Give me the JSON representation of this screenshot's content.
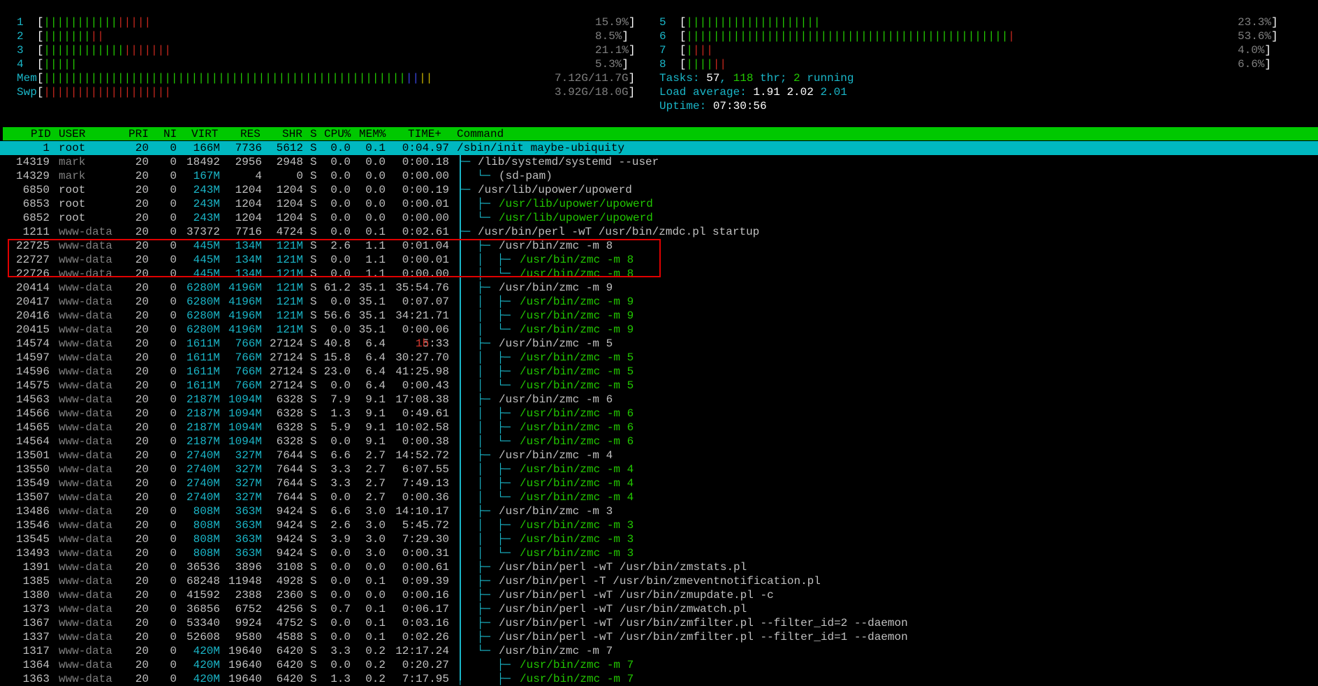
{
  "cpus": [
    {
      "label": "1",
      "green": "|||||||||||",
      "red": "|||||",
      "value": "15.9%"
    },
    {
      "label": "2",
      "green": "|||||||",
      "red": "||",
      "value": "8.5%"
    },
    {
      "label": "3",
      "green": "||||||||||||",
      "red": "|||||||",
      "value": "21.1%"
    },
    {
      "label": "4",
      "green": "|||||",
      "red": "",
      "value": "5.3%"
    },
    {
      "label": "5",
      "green": "||||||||||||||||||||",
      "red": "",
      "value": "23.3%"
    },
    {
      "label": "6",
      "green": "||||||||||||||||||||||||||||||||||||||||||||||||",
      "red": "|",
      "value": "53.6%"
    },
    {
      "label": "7",
      "green": "|",
      "red": "|||",
      "value": "4.0%"
    },
    {
      "label": "8",
      "green": "||||",
      "red": "||",
      "value": "6.6%"
    }
  ],
  "mem": {
    "label": "Mem",
    "green": "||||||||||||||||||||||||||||||||||||||||||||||||||||||",
    "blue": "||",
    "yellow": "||",
    "value": "7.12G/11.7G"
  },
  "swp": {
    "label": "Swp",
    "red": "|||||||||||||||||||",
    "value": "3.92G/18.0G"
  },
  "tasks": {
    "label": "Tasks: ",
    "count": "57",
    "sep1": ", ",
    "thr": "118",
    "thr_label": " thr; ",
    "running": "2",
    "running_label": " running"
  },
  "load": {
    "label": "Load average: ",
    "one": "1.91",
    "five": "2.02",
    "fifteen": "2.01"
  },
  "uptime": {
    "label": "Uptime: ",
    "value": "07:30:56"
  },
  "header": {
    "pid": "PID",
    "user": "USER",
    "pri": "PRI",
    "ni": "NI",
    "virt": "VIRT",
    "res": "RES",
    "shr": "SHR",
    "s": "S",
    "cpu": "CPU%",
    "mem": "MEM%",
    "time": "TIME+",
    "cmd": "Command"
  },
  "processes": [
    {
      "pid": "1",
      "user": "root",
      "pri": "20",
      "ni": "0",
      "virt": "166M",
      "res": "7736",
      "shr": "5612",
      "s": "S",
      "cpu": "0.0",
      "mem": "0.1",
      "time": "0:04.97",
      "tree": "",
      "cmd": "/sbin/init maybe-ubiquity",
      "thread": false,
      "selected": true
    },
    {
      "pid": "14319",
      "user": "mark",
      "pri": "20",
      "ni": "0",
      "virt": "18492",
      "res": "2956",
      "shr": "2948",
      "s": "S",
      "cpu": "0.0",
      "mem": "0.0",
      "time": "0:00.18",
      "tree": "├─ ",
      "cmd": "/lib/systemd/systemd --user",
      "thread": false
    },
    {
      "pid": "14329",
      "user": "mark",
      "pri": "20",
      "ni": "0",
      "virt": "167M",
      "res": "4",
      "shr": "0",
      "s": "S",
      "cpu": "0.0",
      "mem": "0.0",
      "time": "0:00.00",
      "tree": "│  └─ ",
      "cmd": "(sd-pam)",
      "thread": false
    },
    {
      "pid": "6850",
      "user": "root",
      "pri": "20",
      "ni": "0",
      "virt": "243M",
      "res": "1204",
      "shr": "1204",
      "s": "S",
      "cpu": "0.0",
      "mem": "0.0",
      "time": "0:00.19",
      "tree": "├─ ",
      "cmd": "/usr/lib/upower/upowerd",
      "thread": false
    },
    {
      "pid": "6853",
      "user": "root",
      "pri": "20",
      "ni": "0",
      "virt": "243M",
      "res": "1204",
      "shr": "1204",
      "s": "S",
      "cpu": "0.0",
      "mem": "0.0",
      "time": "0:00.01",
      "tree": "│  ├─ ",
      "cmd": "/usr/lib/upower/upowerd",
      "thread": true
    },
    {
      "pid": "6852",
      "user": "root",
      "pri": "20",
      "ni": "0",
      "virt": "243M",
      "res": "1204",
      "shr": "1204",
      "s": "S",
      "cpu": "0.0",
      "mem": "0.0",
      "time": "0:00.00",
      "tree": "│  └─ ",
      "cmd": "/usr/lib/upower/upowerd",
      "thread": true
    },
    {
      "pid": "1211",
      "user": "www-data",
      "pri": "20",
      "ni": "0",
      "virt": "37372",
      "res": "7716",
      "shr": "4724",
      "s": "S",
      "cpu": "0.0",
      "mem": "0.1",
      "time": "0:02.61",
      "tree": "├─ ",
      "cmd": "/usr/bin/perl -wT /usr/bin/zmdc.pl startup",
      "thread": false
    },
    {
      "pid": "22725",
      "user": "www-data",
      "pri": "20",
      "ni": "0",
      "virt": "445M",
      "res": "134M",
      "shr": "121M",
      "s": "S",
      "cpu": "2.6",
      "mem": "1.1",
      "time": "0:01.04",
      "tree": "│  ├─ ",
      "cmd": "/usr/bin/zmc -m 8",
      "thread": false
    },
    {
      "pid": "22727",
      "user": "www-data",
      "pri": "20",
      "ni": "0",
      "virt": "445M",
      "res": "134M",
      "shr": "121M",
      "s": "S",
      "cpu": "0.0",
      "mem": "1.1",
      "time": "0:00.01",
      "tree": "│  │  ├─ ",
      "cmd": "/usr/bin/zmc -m 8",
      "thread": true
    },
    {
      "pid": "22726",
      "user": "www-data",
      "pri": "20",
      "ni": "0",
      "virt": "445M",
      "res": "134M",
      "shr": "121M",
      "s": "S",
      "cpu": "0.0",
      "mem": "1.1",
      "time": "0:00.00",
      "tree": "│  │  └─ ",
      "cmd": "/usr/bin/zmc -m 8",
      "thread": true
    },
    {
      "pid": "20414",
      "user": "www-data",
      "pri": "20",
      "ni": "0",
      "virt": "6280M",
      "res": "4196M",
      "shr": "121M",
      "s": "S",
      "cpu": "61.2",
      "mem": "35.1",
      "time": "35:54.76",
      "tree": "│  ├─ ",
      "cmd": "/usr/bin/zmc -m 9",
      "thread": false
    },
    {
      "pid": "20417",
      "user": "www-data",
      "pri": "20",
      "ni": "0",
      "virt": "6280M",
      "res": "4196M",
      "shr": "121M",
      "s": "S",
      "cpu": "0.0",
      "mem": "35.1",
      "time": "0:07.07",
      "tree": "│  │  ├─ ",
      "cmd": "/usr/bin/zmc -m 9",
      "thread": true
    },
    {
      "pid": "20416",
      "user": "www-data",
      "pri": "20",
      "ni": "0",
      "virt": "6280M",
      "res": "4196M",
      "shr": "121M",
      "s": "S",
      "cpu": "56.6",
      "mem": "35.1",
      "time": "34:21.71",
      "tree": "│  │  ├─ ",
      "cmd": "/usr/bin/zmc -m 9",
      "thread": true
    },
    {
      "pid": "20415",
      "user": "www-data",
      "pri": "20",
      "ni": "0",
      "virt": "6280M",
      "res": "4196M",
      "shr": "121M",
      "s": "S",
      "cpu": "0.0",
      "mem": "35.1",
      "time": "0:00.06",
      "tree": "│  │  └─ ",
      "cmd": "/usr/bin/zmc -m 9",
      "thread": true
    },
    {
      "pid": "14574",
      "user": "www-data",
      "pri": "20",
      "ni": "0",
      "virt": "1611M",
      "res": "766M",
      "shr": "27124",
      "s": "S",
      "cpu": "40.8",
      "mem": "6.4",
      "time": "15:33",
      "time_prefix": "1h",
      "tree": "│  ├─ ",
      "cmd": "/usr/bin/zmc -m 5",
      "thread": false
    },
    {
      "pid": "14597",
      "user": "www-data",
      "pri": "20",
      "ni": "0",
      "virt": "1611M",
      "res": "766M",
      "shr": "27124",
      "s": "S",
      "cpu": "15.8",
      "mem": "6.4",
      "time": "30:27.70",
      "tree": "│  │  ├─ ",
      "cmd": "/usr/bin/zmc -m 5",
      "thread": true
    },
    {
      "pid": "14596",
      "user": "www-data",
      "pri": "20",
      "ni": "0",
      "virt": "1611M",
      "res": "766M",
      "shr": "27124",
      "s": "S",
      "cpu": "23.0",
      "mem": "6.4",
      "time": "41:25.98",
      "tree": "│  │  ├─ ",
      "cmd": "/usr/bin/zmc -m 5",
      "thread": true
    },
    {
      "pid": "14575",
      "user": "www-data",
      "pri": "20",
      "ni": "0",
      "virt": "1611M",
      "res": "766M",
      "shr": "27124",
      "s": "S",
      "cpu": "0.0",
      "mem": "6.4",
      "time": "0:00.43",
      "tree": "│  │  └─ ",
      "cmd": "/usr/bin/zmc -m 5",
      "thread": true
    },
    {
      "pid": "14563",
      "user": "www-data",
      "pri": "20",
      "ni": "0",
      "virt": "2187M",
      "res": "1094M",
      "shr": "6328",
      "s": "S",
      "cpu": "7.9",
      "mem": "9.1",
      "time": "17:08.38",
      "tree": "│  ├─ ",
      "cmd": "/usr/bin/zmc -m 6",
      "thread": false
    },
    {
      "pid": "14566",
      "user": "www-data",
      "pri": "20",
      "ni": "0",
      "virt": "2187M",
      "res": "1094M",
      "shr": "6328",
      "s": "S",
      "cpu": "1.3",
      "mem": "9.1",
      "time": "0:49.61",
      "tree": "│  │  ├─ ",
      "cmd": "/usr/bin/zmc -m 6",
      "thread": true
    },
    {
      "pid": "14565",
      "user": "www-data",
      "pri": "20",
      "ni": "0",
      "virt": "2187M",
      "res": "1094M",
      "shr": "6328",
      "s": "S",
      "cpu": "5.9",
      "mem": "9.1",
      "time": "10:02.58",
      "tree": "│  │  ├─ ",
      "cmd": "/usr/bin/zmc -m 6",
      "thread": true
    },
    {
      "pid": "14564",
      "user": "www-data",
      "pri": "20",
      "ni": "0",
      "virt": "2187M",
      "res": "1094M",
      "shr": "6328",
      "s": "S",
      "cpu": "0.0",
      "mem": "9.1",
      "time": "0:00.38",
      "tree": "│  │  └─ ",
      "cmd": "/usr/bin/zmc -m 6",
      "thread": true
    },
    {
      "pid": "13501",
      "user": "www-data",
      "pri": "20",
      "ni": "0",
      "virt": "2740M",
      "res": "327M",
      "shr": "7644",
      "s": "S",
      "cpu": "6.6",
      "mem": "2.7",
      "time": "14:52.72",
      "tree": "│  ├─ ",
      "cmd": "/usr/bin/zmc -m 4",
      "thread": false
    },
    {
      "pid": "13550",
      "user": "www-data",
      "pri": "20",
      "ni": "0",
      "virt": "2740M",
      "res": "327M",
      "shr": "7644",
      "s": "S",
      "cpu": "3.3",
      "mem": "2.7",
      "time": "6:07.55",
      "tree": "│  │  ├─ ",
      "cmd": "/usr/bin/zmc -m 4",
      "thread": true
    },
    {
      "pid": "13549",
      "user": "www-data",
      "pri": "20",
      "ni": "0",
      "virt": "2740M",
      "res": "327M",
      "shr": "7644",
      "s": "S",
      "cpu": "3.3",
      "mem": "2.7",
      "time": "7:49.13",
      "tree": "│  │  ├─ ",
      "cmd": "/usr/bin/zmc -m 4",
      "thread": true
    },
    {
      "pid": "13507",
      "user": "www-data",
      "pri": "20",
      "ni": "0",
      "virt": "2740M",
      "res": "327M",
      "shr": "7644",
      "s": "S",
      "cpu": "0.0",
      "mem": "2.7",
      "time": "0:00.36",
      "tree": "│  │  └─ ",
      "cmd": "/usr/bin/zmc -m 4",
      "thread": true
    },
    {
      "pid": "13486",
      "user": "www-data",
      "pri": "20",
      "ni": "0",
      "virt": "808M",
      "res": "363M",
      "shr": "9424",
      "s": "S",
      "cpu": "6.6",
      "mem": "3.0",
      "time": "14:10.17",
      "tree": "│  ├─ ",
      "cmd": "/usr/bin/zmc -m 3",
      "thread": false
    },
    {
      "pid": "13546",
      "user": "www-data",
      "pri": "20",
      "ni": "0",
      "virt": "808M",
      "res": "363M",
      "shr": "9424",
      "s": "S",
      "cpu": "2.6",
      "mem": "3.0",
      "time": "5:45.72",
      "tree": "│  │  ├─ ",
      "cmd": "/usr/bin/zmc -m 3",
      "thread": true
    },
    {
      "pid": "13545",
      "user": "www-data",
      "pri": "20",
      "ni": "0",
      "virt": "808M",
      "res": "363M",
      "shr": "9424",
      "s": "S",
      "cpu": "3.9",
      "mem": "3.0",
      "time": "7:29.30",
      "tree": "│  │  ├─ ",
      "cmd": "/usr/bin/zmc -m 3",
      "thread": true
    },
    {
      "pid": "13493",
      "user": "www-data",
      "pri": "20",
      "ni": "0",
      "virt": "808M",
      "res": "363M",
      "shr": "9424",
      "s": "S",
      "cpu": "0.0",
      "mem": "3.0",
      "time": "0:00.31",
      "tree": "│  │  └─ ",
      "cmd": "/usr/bin/zmc -m 3",
      "thread": true
    },
    {
      "pid": "1391",
      "user": "www-data",
      "pri": "20",
      "ni": "0",
      "virt": "36536",
      "res": "3896",
      "shr": "3108",
      "s": "S",
      "cpu": "0.0",
      "mem": "0.0",
      "time": "0:00.61",
      "tree": "│  ├─ ",
      "cmd": "/usr/bin/perl -wT /usr/bin/zmstats.pl",
      "thread": false
    },
    {
      "pid": "1385",
      "user": "www-data",
      "pri": "20",
      "ni": "0",
      "virt": "68248",
      "res": "11948",
      "shr": "4928",
      "s": "S",
      "cpu": "0.0",
      "mem": "0.1",
      "time": "0:09.39",
      "tree": "│  ├─ ",
      "cmd": "/usr/bin/perl -T /usr/bin/zmeventnotification.pl",
      "thread": false
    },
    {
      "pid": "1380",
      "user": "www-data",
      "pri": "20",
      "ni": "0",
      "virt": "41592",
      "res": "2388",
      "shr": "2360",
      "s": "S",
      "cpu": "0.0",
      "mem": "0.0",
      "time": "0:00.16",
      "tree": "│  ├─ ",
      "cmd": "/usr/bin/perl -wT /usr/bin/zmupdate.pl -c",
      "thread": false
    },
    {
      "pid": "1373",
      "user": "www-data",
      "pri": "20",
      "ni": "0",
      "virt": "36856",
      "res": "6752",
      "shr": "4256",
      "s": "S",
      "cpu": "0.7",
      "mem": "0.1",
      "time": "0:06.17",
      "tree": "│  ├─ ",
      "cmd": "/usr/bin/perl -wT /usr/bin/zmwatch.pl",
      "thread": false
    },
    {
      "pid": "1367",
      "user": "www-data",
      "pri": "20",
      "ni": "0",
      "virt": "53340",
      "res": "9924",
      "shr": "4752",
      "s": "S",
      "cpu": "0.0",
      "mem": "0.1",
      "time": "0:03.16",
      "tree": "│  ├─ ",
      "cmd": "/usr/bin/perl -wT /usr/bin/zmfilter.pl --filter_id=2 --daemon",
      "thread": false
    },
    {
      "pid": "1337",
      "user": "www-data",
      "pri": "20",
      "ni": "0",
      "virt": "52608",
      "res": "9580",
      "shr": "4588",
      "s": "S",
      "cpu": "0.0",
      "mem": "0.1",
      "time": "0:02.26",
      "tree": "│  ├─ ",
      "cmd": "/usr/bin/perl -wT /usr/bin/zmfilter.pl --filter_id=1 --daemon",
      "thread": false
    },
    {
      "pid": "1317",
      "user": "www-data",
      "pri": "20",
      "ni": "0",
      "virt": "420M",
      "res": "19640",
      "shr": "6420",
      "s": "S",
      "cpu": "3.3",
      "mem": "0.2",
      "time": "12:17.24",
      "tree": "│  └─ ",
      "cmd": "/usr/bin/zmc -m 7",
      "thread": false
    },
    {
      "pid": "1364",
      "user": "www-data",
      "pri": "20",
      "ni": "0",
      "virt": "420M",
      "res": "19640",
      "shr": "6420",
      "s": "S",
      "cpu": "0.0",
      "mem": "0.2",
      "time": "0:20.27",
      "tree": "│     ├─ ",
      "cmd": "/usr/bin/zmc -m 7",
      "thread": true
    },
    {
      "pid": "1363",
      "user": "www-data",
      "pri": "20",
      "ni": "0",
      "virt": "420M",
      "res": "19640",
      "shr": "6420",
      "s": "S",
      "cpu": "1.3",
      "mem": "0.2",
      "time": "7:17.95",
      "tree": "│     ├─ ",
      "cmd": "/usr/bin/zmc -m 7",
      "thread": true
    }
  ]
}
